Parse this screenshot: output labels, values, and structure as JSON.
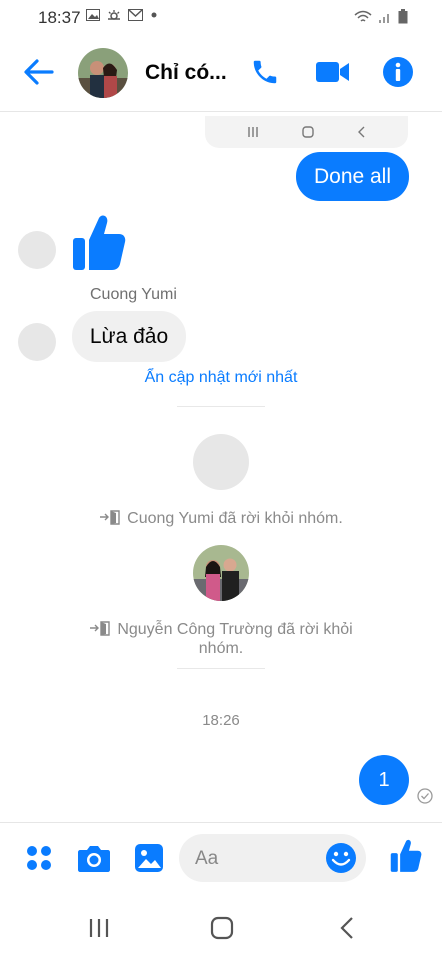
{
  "status_bar": {
    "time": "18:37",
    "left_icons": [
      "image-icon",
      "weather-icon",
      "gmail-icon",
      "dot-icon"
    ],
    "right_icons": [
      "wifi-icon",
      "signal-icon",
      "battery-icon"
    ]
  },
  "header": {
    "title": "Chỉ có...",
    "back_icon": "back-arrow-icon",
    "actions": [
      "phone-icon",
      "video-camera-icon",
      "info-icon"
    ]
  },
  "messages": {
    "outgoing_1": "Done all",
    "sender_name": "Cuong Yumi",
    "incoming_1": "Lừa đảo",
    "hide_updates": "Ẩn cập nhật mới nhất",
    "system_1": "Cuong Yumi đã rời khỏi nhóm.",
    "system_2_line1": "Nguyễn Công Trường đã rời khỏi",
    "system_2_line2": "nhóm.",
    "timestamp": "18:26",
    "outgoing_2": "1"
  },
  "composer": {
    "placeholder": "Aa",
    "buttons": [
      "apps-icon",
      "camera-icon",
      "gallery-icon",
      "emoji-icon",
      "like-icon"
    ]
  },
  "colors": {
    "accent": "#0a7cff",
    "bubble_in": "#f0f0f0",
    "system_text": "#8a8a8a"
  }
}
